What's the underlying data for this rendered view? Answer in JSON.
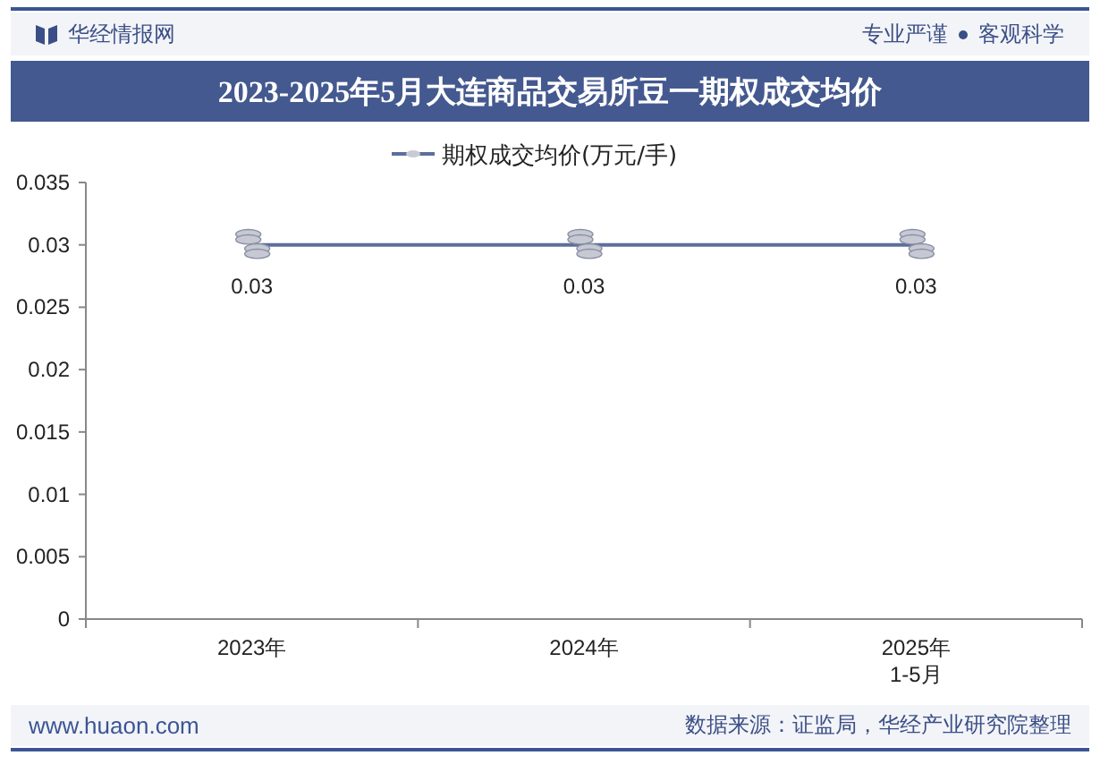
{
  "header": {
    "brand": "华经情报网",
    "slogans": [
      "专业严谨",
      "客观科学"
    ]
  },
  "title": "2023-2025年5月大连商品交易所豆一期权成交均价",
  "chart_data": {
    "type": "line",
    "categories": [
      "2023年",
      "2024年",
      "2025年1-5月"
    ],
    "series": [
      {
        "name": "期权成交均价(万元/手)",
        "color": "#5b6f9c",
        "values": [
          0.03,
          0.03,
          0.03
        ]
      }
    ],
    "ylim": [
      0,
      0.035
    ],
    "yticks": [
      0,
      0.005,
      0.01,
      0.015,
      0.02,
      0.025,
      0.03,
      0.035
    ],
    "data_labels": true
  },
  "footer": {
    "site": "www.huaon.com",
    "source": "数据来源：证监局，华经产业研究院整理"
  }
}
